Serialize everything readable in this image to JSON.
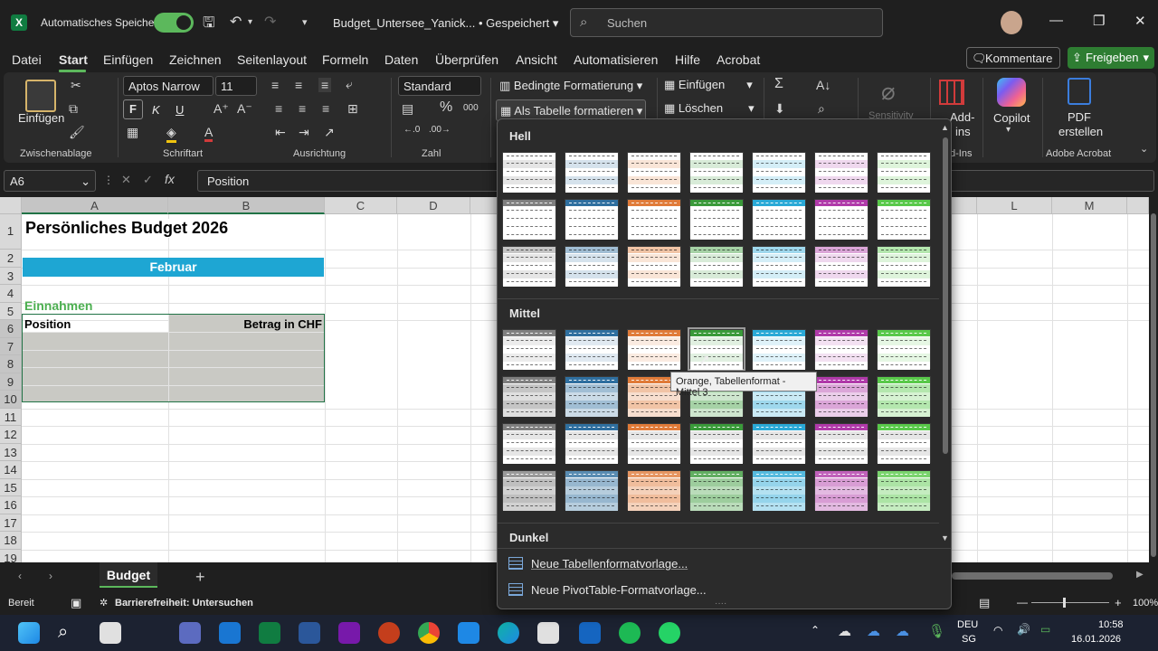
{
  "titlebar": {
    "app_icon": "X",
    "autosave_label": "Automatisches Speichern",
    "doc_name": "Budget_Untersee_Yanick...",
    "saved_status": "• Gespeichert",
    "search_placeholder": "Suchen"
  },
  "menu": {
    "items": [
      "Datei",
      "Start",
      "Einfügen",
      "Zeichnen",
      "Seitenlayout",
      "Formeln",
      "Daten",
      "Überprüfen",
      "Ansicht",
      "Automatisieren",
      "Hilfe",
      "Acrobat"
    ],
    "comments_button": "Kommentare",
    "share_button": "Freigeben"
  },
  "ribbon": {
    "paste_label": "Einfügen",
    "clipboard_group": "Zwischenablage",
    "font_name": "Aptos Narrow",
    "font_size": "11",
    "bold": "F",
    "italic": "K",
    "underline": "U",
    "font_group": "Schriftart",
    "align_group": "Ausrichtung",
    "number_format": "Standard",
    "number_group": "Zahl",
    "conditional_formatting": "Bedingte Formatierung",
    "format_as_table": "Als Tabelle formatieren",
    "insert_label": "Einfügen",
    "delete_label": "Löschen",
    "sensitivity_label": "Sensitivity",
    "addins_label_top": "Add-",
    "addins_label_bottom": "ins",
    "addins_group_fragment": "d-Ins",
    "copilot_label": "Copilot",
    "pdf_label_1": "PDF",
    "pdf_label_2": "erstellen",
    "acrobat_group": "Adobe Acrobat"
  },
  "formula_bar": {
    "name_box": "A6",
    "formula": "Position"
  },
  "sheet": {
    "columns": [
      "A",
      "B",
      "C",
      "D",
      "L",
      "M"
    ],
    "rows": [
      "1",
      "2",
      "3",
      "4",
      "5",
      "6",
      "7",
      "8",
      "9",
      "10",
      "11",
      "12",
      "13",
      "14",
      "15",
      "16",
      "17",
      "18",
      "19"
    ],
    "title": "Persönliches Budget 2026",
    "month_banner": "Februar",
    "section_income": "Einnahmen",
    "header_position": "Position",
    "header_amount": "Betrag in CHF"
  },
  "gallery": {
    "section_light": "Hell",
    "section_medium": "Mittel",
    "section_dark": "Dunkel",
    "new_table_style": "Neue Tabellenformatvorlage...",
    "new_pivot_style": "Neue PivotTable-Formatvorlage...",
    "tooltip": "Orange, Tabellenformat - Mittel 3",
    "colors": [
      "#7f7f7f",
      "#2f6f9f",
      "#e07b39",
      "#3a9a3a",
      "#2aa9d6",
      "#b03aa9",
      "#59c94a"
    ]
  },
  "tabs": {
    "active_sheet": "Budget",
    "add_sheet": "+"
  },
  "status": {
    "ready": "Bereit",
    "accessibility": "Barrierefreiheit: Untersuchen",
    "zoom": "100%"
  },
  "taskbar": {
    "lang_1": "DEU",
    "lang_2": "SG",
    "time": "10:58",
    "date": "16.01.2026"
  }
}
